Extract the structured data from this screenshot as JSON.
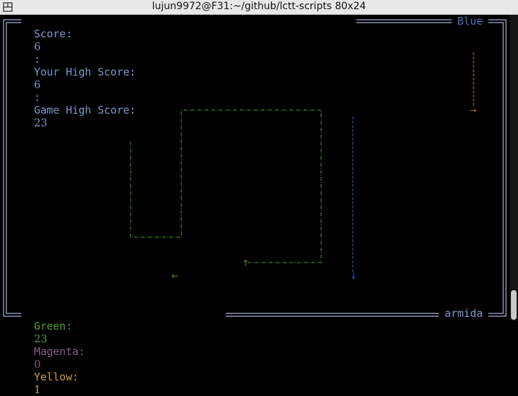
{
  "window": {
    "title": "lujun9972@F31:~/github/lctt-scripts 80x24"
  },
  "hud_top": {
    "score_label": "Score:",
    "score": "6",
    "sep1": ":",
    "your_high_label": "Your High Score:",
    "your_high": "6",
    "sep2": ":",
    "game_high_label": "Game High Score:",
    "game_high": "23",
    "player_color": "Blue"
  },
  "hud_bottom": {
    "green_label": "Green:",
    "green": "23",
    "magenta_label": "Magenta:",
    "magenta": "0",
    "yellow_label": "Yellow:",
    "yellow": "1",
    "hostname": "armida"
  },
  "colors": {
    "border": "#a9b4d6",
    "blue": "#2f63b8",
    "green": "#5a9f2a",
    "magenta": "#8b5e83",
    "yellow": "#c8a13a",
    "orange": "#d9831a",
    "label": "#7f97c8"
  },
  "snakes": [
    {
      "color": "green",
      "head": "↑",
      "direction": "up"
    },
    {
      "color": "green",
      "head": "←",
      "direction": "left"
    },
    {
      "color": "blue",
      "head": "↓",
      "direction": "down"
    },
    {
      "color": "orange",
      "head": "→",
      "direction": "right"
    }
  ]
}
